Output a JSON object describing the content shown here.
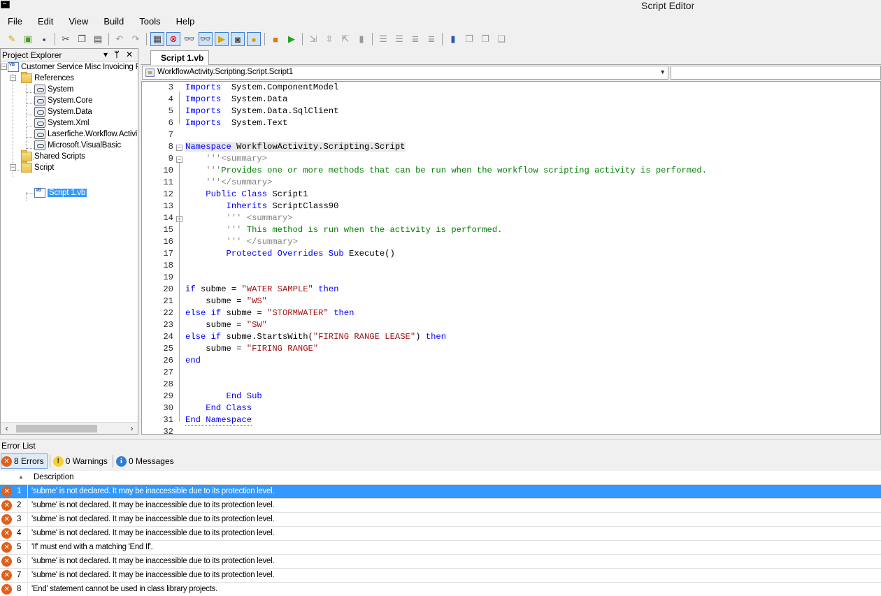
{
  "window": {
    "title": "Script Editor"
  },
  "menu": [
    "File",
    "Edit",
    "View",
    "Build",
    "Tools",
    "Help"
  ],
  "project_explorer": {
    "title": "Project Explorer",
    "header_buttons": "▾ ᛘ ✕",
    "tree": {
      "project": "Customer Service Misc Invoicing P",
      "references": "References",
      "ref_items": [
        "System",
        "System.Core",
        "System.Data",
        "System.Xml",
        "Laserfiche.Workflow.Activi",
        "Microsoft.VisualBasic"
      ],
      "shared_scripts": "Shared Scripts",
      "script_folder": "Script",
      "script_file": "Script 1.vb"
    }
  },
  "editor": {
    "tab_label": "Script 1.vb",
    "class_combo": "WorkflowActivity.Scripting.Script.Script1",
    "member_combo": ""
  },
  "error_list": {
    "title": "Error List",
    "errors_label": "8 Errors",
    "warnings_label": "0 Warnings",
    "messages_label": "0 Messages",
    "column_description": "Description",
    "rows": [
      {
        "num": "1",
        "desc": "'subme' is not declared. It may be inaccessible due to its protection level."
      },
      {
        "num": "2",
        "desc": "'subme' is not declared. It may be inaccessible due to its protection level."
      },
      {
        "num": "3",
        "desc": "'subme' is not declared. It may be inaccessible due to its protection level."
      },
      {
        "num": "4",
        "desc": "'subme' is not declared. It may be inaccessible due to its protection level."
      },
      {
        "num": "5",
        "desc": "'If' must end with a matching 'End If'."
      },
      {
        "num": "6",
        "desc": "'subme' is not declared. It may be inaccessible due to its protection level."
      },
      {
        "num": "7",
        "desc": "'subme' is not declared. It may be inaccessible due to its protection level."
      },
      {
        "num": "8",
        "desc": "'End' statement cannot be used in class library projects."
      }
    ]
  },
  "code_lines": [
    {
      "n": "3",
      "parts": [
        [
          "kw",
          "Imports"
        ],
        [
          "",
          "  System.ComponentModel"
        ]
      ]
    },
    {
      "n": "4",
      "parts": [
        [
          "kw",
          "Imports"
        ],
        [
          "",
          "  System.Data"
        ]
      ]
    },
    {
      "n": "5",
      "parts": [
        [
          "kw",
          "Imports"
        ],
        [
          "",
          "  System.Data.SqlClient"
        ]
      ]
    },
    {
      "n": "6",
      "parts": [
        [
          "kw",
          "Imports"
        ],
        [
          "",
          "  System.Text"
        ]
      ]
    },
    {
      "n": "7",
      "parts": []
    },
    {
      "n": "8",
      "parts": [
        [
          "kw",
          "Namespace"
        ],
        [
          "",
          " WorkflowActivity.Scripting.Script"
        ]
      ]
    },
    {
      "n": "9",
      "parts": [
        [
          "cmg",
          "    '''<summary>"
        ]
      ]
    },
    {
      "n": "10",
      "parts": [
        [
          "cmg",
          "    '''"
        ],
        [
          "cm",
          "Provides one or more methods that can be run when the workflow scripting activity is performed."
        ]
      ]
    },
    {
      "n": "11",
      "parts": [
        [
          "cmg",
          "    '''</summary>"
        ]
      ]
    },
    {
      "n": "12",
      "parts": [
        [
          "kw",
          "    Public Class"
        ],
        [
          "",
          " Script1"
        ]
      ]
    },
    {
      "n": "13",
      "parts": [
        [
          "kw",
          "        Inherits"
        ],
        [
          "",
          " ScriptClass90"
        ]
      ]
    },
    {
      "n": "14",
      "parts": [
        [
          "cmg",
          "        ''' <summary>"
        ]
      ]
    },
    {
      "n": "15",
      "parts": [
        [
          "cmg",
          "        ''' "
        ],
        [
          "cm",
          "This method is run when the activity is performed."
        ]
      ]
    },
    {
      "n": "16",
      "parts": [
        [
          "cmg",
          "        ''' </summary>"
        ]
      ]
    },
    {
      "n": "17",
      "parts": [
        [
          "kw",
          "        Protected Overrides Sub"
        ],
        [
          "",
          " Execute()"
        ]
      ]
    },
    {
      "n": "18",
      "parts": []
    },
    {
      "n": "19",
      "parts": []
    },
    {
      "n": "20",
      "parts": [
        [
          "kw",
          "if"
        ],
        [
          "",
          " subme = "
        ],
        [
          "st",
          "\"WATER SAMPLE\""
        ],
        [
          "",
          " "
        ],
        [
          "kw",
          "then"
        ]
      ]
    },
    {
      "n": "21",
      "parts": [
        [
          "",
          "    subme = "
        ],
        [
          "st",
          "\"WS\""
        ]
      ]
    },
    {
      "n": "22",
      "parts": [
        [
          "kw",
          "else if"
        ],
        [
          "",
          " subme = "
        ],
        [
          "st",
          "\"STORMWATER\""
        ],
        [
          "",
          " "
        ],
        [
          "kw",
          "then"
        ]
      ]
    },
    {
      "n": "23",
      "parts": [
        [
          "",
          "    subme = "
        ],
        [
          "st",
          "\"SW\""
        ]
      ]
    },
    {
      "n": "24",
      "parts": [
        [
          "kw",
          "else if"
        ],
        [
          "",
          " subme.StartsWith("
        ],
        [
          "st",
          "\"FIRING RANGE LEASE\""
        ],
        [
          "",
          ") "
        ],
        [
          "kw",
          "then"
        ]
      ]
    },
    {
      "n": "25",
      "parts": [
        [
          "",
          "    subme = "
        ],
        [
          "st",
          "\"FIRING RANGE\""
        ]
      ]
    },
    {
      "n": "26",
      "parts": [
        [
          "kw",
          "end"
        ]
      ]
    },
    {
      "n": "27",
      "parts": []
    },
    {
      "n": "28",
      "parts": []
    },
    {
      "n": "29",
      "parts": [
        [
          "kw",
          "        End Sub"
        ]
      ]
    },
    {
      "n": "30",
      "parts": [
        [
          "kw",
          "    End Class"
        ]
      ]
    },
    {
      "n": "31",
      "parts": [
        [
          "kw",
          "End Namespace"
        ]
      ]
    },
    {
      "n": "32",
      "parts": []
    }
  ]
}
